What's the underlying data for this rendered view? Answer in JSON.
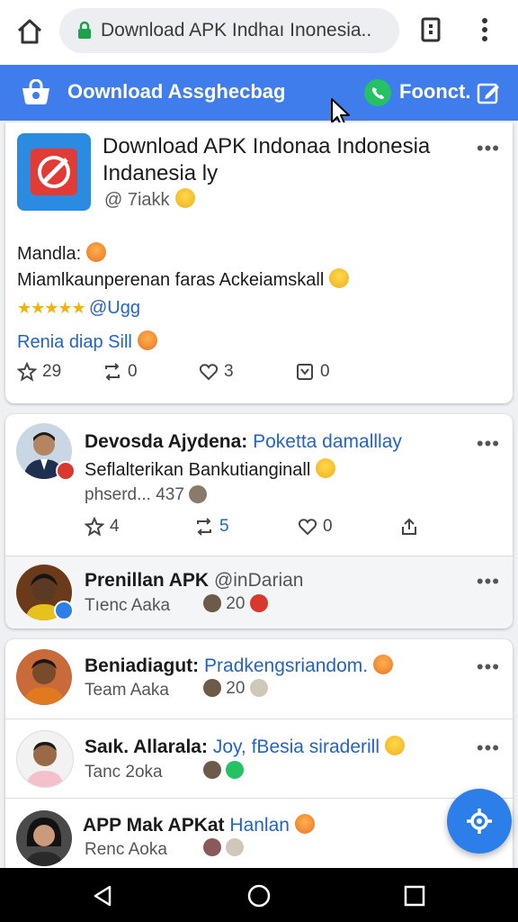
{
  "browser": {
    "url": "Download APK Indhaı Inonesia..",
    "icons": [
      "home-icon",
      "lock-icon",
      "tabs-icon",
      "menu-dots-icon"
    ]
  },
  "banner": {
    "title": "Oownload Assghecbag",
    "connect_label": "Foonct.",
    "color": "#3f7cec"
  },
  "post1": {
    "title": "Download APK Indonaa Indonesia Indanesia ly",
    "handle": "@ 7iakk",
    "line1": "Mandla:",
    "line2": "Miamlkaunperenan faras Ackeiamskall",
    "stars": "★★★★★",
    "tag": "@Ugg",
    "link": "Renia diap Sill",
    "actions": {
      "likes": "29",
      "reposts": "0",
      "hearts": "3",
      "shares": "0"
    }
  },
  "post2": {
    "author": "Devosda Ajydena:",
    "author_tail": "Poketta damalllay",
    "text": "Seflalterikan Bankutianginall",
    "meta": "phserd... 437",
    "actions": {
      "likes": "4",
      "reposts": "5",
      "hearts": "0"
    }
  },
  "post2_reply": {
    "name": "Prenillan APK",
    "handle": "@inDarian",
    "sub": "Tıenc Aaka",
    "count": "20"
  },
  "list": [
    {
      "name": "Beniadiagut:",
      "tail": "Pradkengsriandom.",
      "sub": "Team Aaka",
      "count": "20"
    },
    {
      "name": "Saık. Allarala:",
      "tail": "Joy, fBesia siraderill",
      "sub": "Tanc 2oka",
      "count": ""
    },
    {
      "name": "APP Mak APKat",
      "tail": "Hanlan",
      "sub": "Renc Aoka",
      "count": ""
    }
  ],
  "more_label": "•••"
}
